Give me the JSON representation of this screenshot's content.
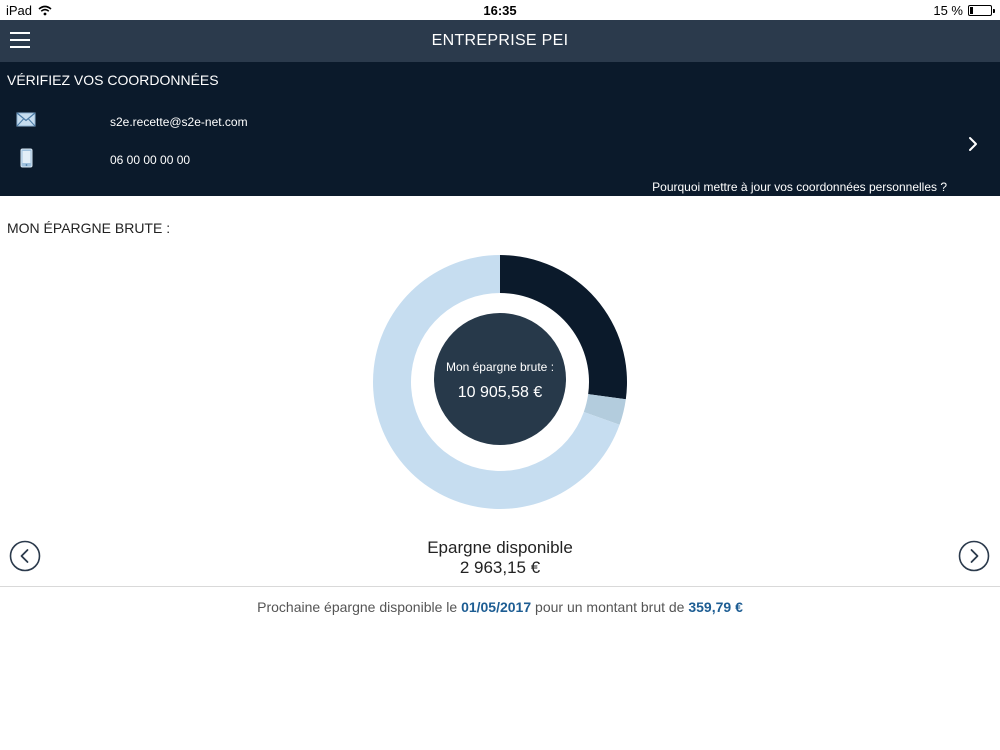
{
  "status_bar": {
    "device": "iPad",
    "time": "16:35",
    "battery": "15 %",
    "battery_level": 0.15
  },
  "header": {
    "title": "ENTREPRISE PEI",
    "menu_icon": "hamburger-menu-icon"
  },
  "contact": {
    "heading": "VÉRIFIEZ VOS COORDONNÉES",
    "email": "s2e.recette@s2e-net.com",
    "email_icon": "envelope-icon",
    "phone": "06 00 00 00 00",
    "phone_icon": "mobile-phone-icon",
    "why_link": "Pourquoi mettre à jour vos coordonnées personnelles ?"
  },
  "savings": {
    "section_title": "MON ÉPARGNE BRUTE :",
    "center_label": "Mon épargne brute :",
    "center_value": "10 905,58 €",
    "available_label": "Epargne disponible",
    "available_value": "2 963,15 €",
    "next_prefix": "Prochaine épargne disponible le",
    "next_date": "01/05/2017",
    "next_middle": "pour un montant brut de",
    "next_amount": "359,79 €"
  },
  "chart_data": {
    "type": "pie",
    "slices": [
      {
        "value": 2963.15,
        "color": "#0b1a2b"
      },
      {
        "value": 359.79,
        "color": "#b3ccdd"
      },
      {
        "value": 7582.64,
        "color": "#c6ddf0"
      }
    ],
    "total": 10905.58
  },
  "colors": {
    "nav_bg": "#2b3a4c",
    "panel_bg": "#0b1a2b",
    "accent": "#1d5d93",
    "arrow": "#2b3a4c"
  }
}
